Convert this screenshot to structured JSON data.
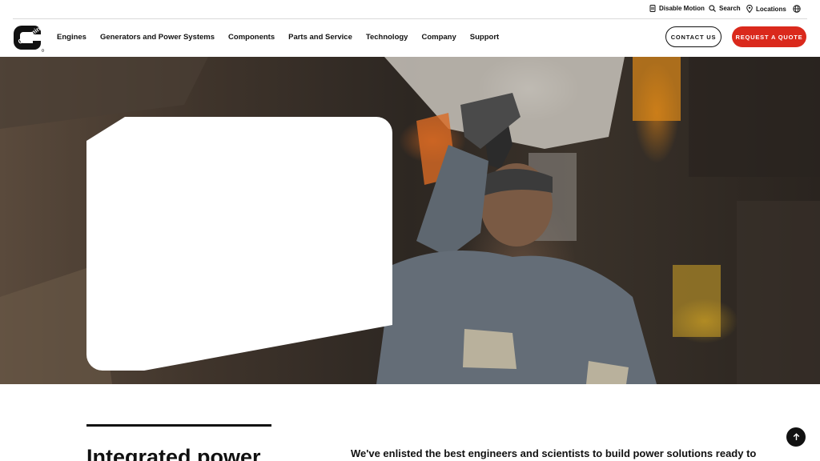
{
  "utility": {
    "disable_motion": "Disable Motion",
    "search": "Search",
    "locations": "Locations",
    "icons": [
      "pause-icon",
      "search-icon",
      "location-pin-icon",
      "globe-icon"
    ]
  },
  "brand": {
    "logo_text": "Cummins",
    "logo_color": "#111111"
  },
  "nav": {
    "items": [
      {
        "label": "Engines"
      },
      {
        "label": "Generators and Power Systems"
      },
      {
        "label": "Components"
      },
      {
        "label": "Parts and Service"
      },
      {
        "label": "Technology"
      },
      {
        "label": "Company"
      },
      {
        "label": "Support"
      }
    ],
    "contact_label": "CONTACT US",
    "quote_label": "REQUEST A QUOTE"
  },
  "colors": {
    "accent": "#da291c",
    "text": "#111111"
  },
  "section": {
    "title": "Integrated power",
    "text": "We've enlisted the best engineers and scientists to build power solutions ready to"
  },
  "scroll_top_icon": "arrow-up-icon"
}
